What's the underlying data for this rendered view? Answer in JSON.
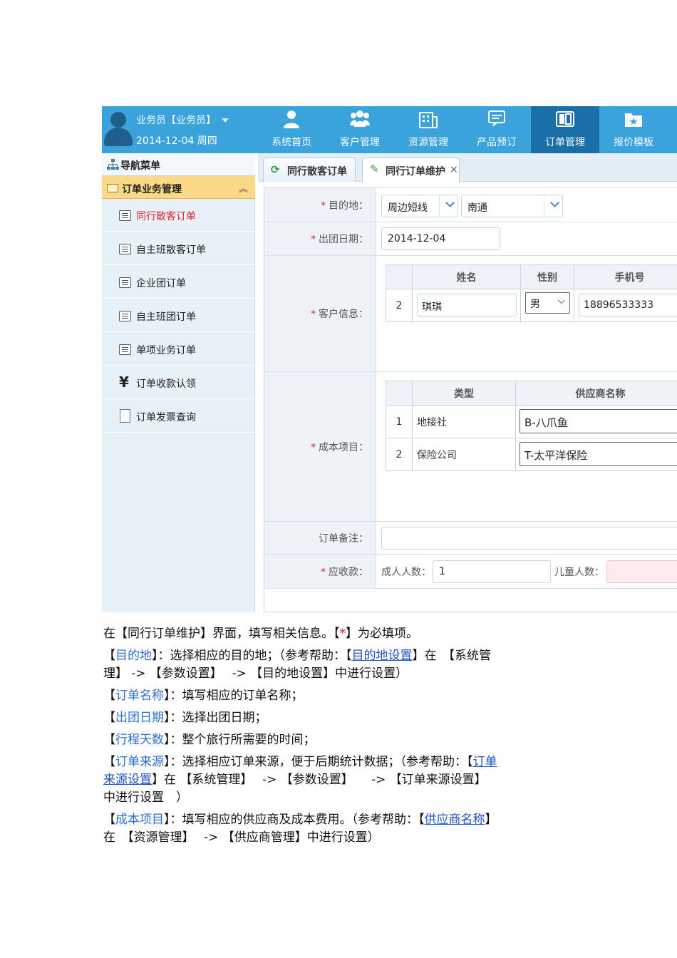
{
  "header": {
    "user_name": "业务员【业务员】",
    "user_date": "2014-12-04 周四",
    "nav": [
      {
        "label": "系统首页",
        "icon": "user-icon"
      },
      {
        "label": "客户管理",
        "icon": "customers-icon"
      },
      {
        "label": "资源管理",
        "icon": "building-icon"
      },
      {
        "label": "产品预订",
        "icon": "news-icon"
      },
      {
        "label": "订单管理",
        "icon": "book-icon"
      },
      {
        "label": "报价模板",
        "icon": "star-folder-icon"
      }
    ],
    "active_nav": "订单管理"
  },
  "sidebar": {
    "title": "导航菜单",
    "group": "订单业务管理",
    "items": [
      {
        "label": "同行散客订单",
        "active": true
      },
      {
        "label": "自主班散客订单"
      },
      {
        "label": "企业团订单"
      },
      {
        "label": "自主班团订单"
      },
      {
        "label": "单项业务订单"
      },
      {
        "label": "订单收款认领",
        "icon": "yen-icon"
      },
      {
        "label": "订单发票查询",
        "icon": "invoice-icon"
      }
    ]
  },
  "tabs": [
    {
      "label": "同行散客订单",
      "icon": "refresh-icon"
    },
    {
      "label": "同行订单维护",
      "icon": "pencil-icon",
      "close": "×",
      "active": true
    }
  ],
  "form": {
    "destination_label": "目的地：",
    "destination_values": [
      "周边短线",
      "南通"
    ],
    "date_label": "出团日期：",
    "date_value": "2014-12-04",
    "customer_label": "客户信息：",
    "customer_headers": [
      "姓名",
      "性别",
      "手机号"
    ],
    "customer_rows": [
      {
        "no": "2",
        "name": "琪琪",
        "gender": "男",
        "phone": "18896533333"
      }
    ],
    "cost_label": "成本项目：",
    "cost_headers": [
      "类型",
      "供应商名称"
    ],
    "cost_rows": [
      {
        "no": "1",
        "type": "地接社",
        "supplier": "B-八爪鱼"
      },
      {
        "no": "2",
        "type": "保险公司",
        "supplier": "T-太平洋保险"
      }
    ],
    "remark_label": "订单备注：",
    "receivable_label": "应收款：",
    "adult_label": "成人人数：",
    "adult_value": "1",
    "child_label": "儿童人数：",
    "required_mark": "*"
  },
  "doc": {
    "l1a": "在【同行订单维护】界面，填写相关信息。【",
    "l1b": "*",
    "l1c": "】为必填项。",
    "l2a": "【",
    "l2b": "目的地",
    "l2c": "】：选择相应的目的地；（参考帮助：【",
    "l2d": "目的地设置",
    "l2e": "】在　【系统管",
    "l3": "理】 -> 【参数设置】　 -> 【目的地设置】中进行设置）",
    "l4a": "【",
    "l4b": "订单名称",
    "l4c": "】：填写相应的订单名称；",
    "l5a": "【",
    "l5b": "出团日期",
    "l5c": "】：选择出团日期；",
    "l6a": "【",
    "l6b": "行程天数",
    "l6c": "】：整个旅行所需要的时间；",
    "l7a": "【",
    "l7b": "订单来源",
    "l7c": "】：选择相应订单来源，便于后期统计数据；（参考帮助：【",
    "l7d": "订单",
    "l8a": "来源设置",
    "l8b": "】在 【系统管理】　 -> 【参数设置】　　-> 【订单来源设置】",
    "l9": "中进行设置　）",
    "l10a": "【",
    "l10b": "成本项目",
    "l10c": "】：填写相应的供应商及成本费用。（参考帮助：【",
    "l10d": "供应商名称",
    "l10e": "】",
    "l11": "在　【资源管理】　 -> 【供应商管理】中进行设置）"
  }
}
